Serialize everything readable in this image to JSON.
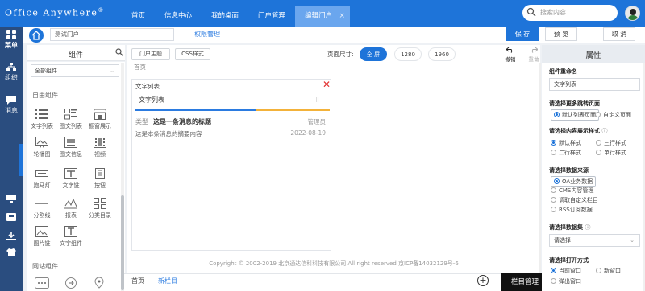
{
  "header": {
    "logo": "Office Anywhere",
    "logo_mark": "®",
    "nav_tabs": [
      "首页",
      "信息中心",
      "我的桌面",
      "门户管理",
      "编辑门户"
    ],
    "active_tab_close": "×",
    "search_placeholder": "搜索内容"
  },
  "leftnav": {
    "items": [
      "菜单",
      "组织",
      "消息"
    ]
  },
  "toolbar": {
    "portal_name": "测试门户",
    "permission_label": "权限管理",
    "save": "保 存",
    "preview": "预 览",
    "cancel": "取 消"
  },
  "components": {
    "title": "组件",
    "filter": "全部组件",
    "free_section": "自由组件",
    "items": [
      "文字列表",
      "图文列表",
      "橱窗展示",
      "轮播图",
      "图文信息",
      "视频",
      "跑马灯",
      "文字链",
      "按钮",
      "分割线",
      "报表",
      "分类目录",
      "图片链",
      "文字组件"
    ],
    "site_section": "网站组件"
  },
  "canvas_toolbar": {
    "theme": "门户主题",
    "css": "CSS样式",
    "page_size_label": "页面尺寸:",
    "sizes": [
      "全 屏",
      "1280",
      "1960"
    ],
    "undo": "撤销",
    "redo": "重做"
  },
  "canvas": {
    "page_label": "首页",
    "card": {
      "label": "文字列表",
      "tab": "文字列表",
      "row1_type": "类型",
      "row1_title": "这是一条消息的标题",
      "row1_author": "管理员",
      "row2_summary": "这是本条消息的摘要内容",
      "row2_date": "2022-08-19"
    },
    "footer": "Copyright © 2002-2019 北京通达信科科技有限公司 All right reserved 京ICP备14032129号-6"
  },
  "bottom": {
    "tabs": [
      "首页",
      "新栏目"
    ],
    "add": "+",
    "manage": "栏目管理"
  },
  "properties": {
    "title": "属性",
    "name_label": "组件重命名",
    "name_value": "文字列表",
    "more_label": "请选择更多跳转页面",
    "more_opts": [
      "默认列表页面",
      "自定义页面"
    ],
    "style_label": "请选择内容展示样式",
    "style_opts": [
      "默认样式",
      "三行样式",
      "二行样式",
      "单行样式"
    ],
    "source_label": "请选择数据来源",
    "source_opts": [
      "OA业务数据",
      "CMS内容管理",
      "调取自定义栏目",
      "RSS订阅数据"
    ],
    "dataset_label": "请选择数据集",
    "dataset_value": "请选择",
    "open_label": "请选择打开方式",
    "open_opts": [
      "当前窗口",
      "新窗口",
      "弹出窗口"
    ]
  },
  "colors": {
    "brand_blue": "#1e74d9",
    "left_nav": "#2a4d7f",
    "close_red": "#e23030"
  }
}
